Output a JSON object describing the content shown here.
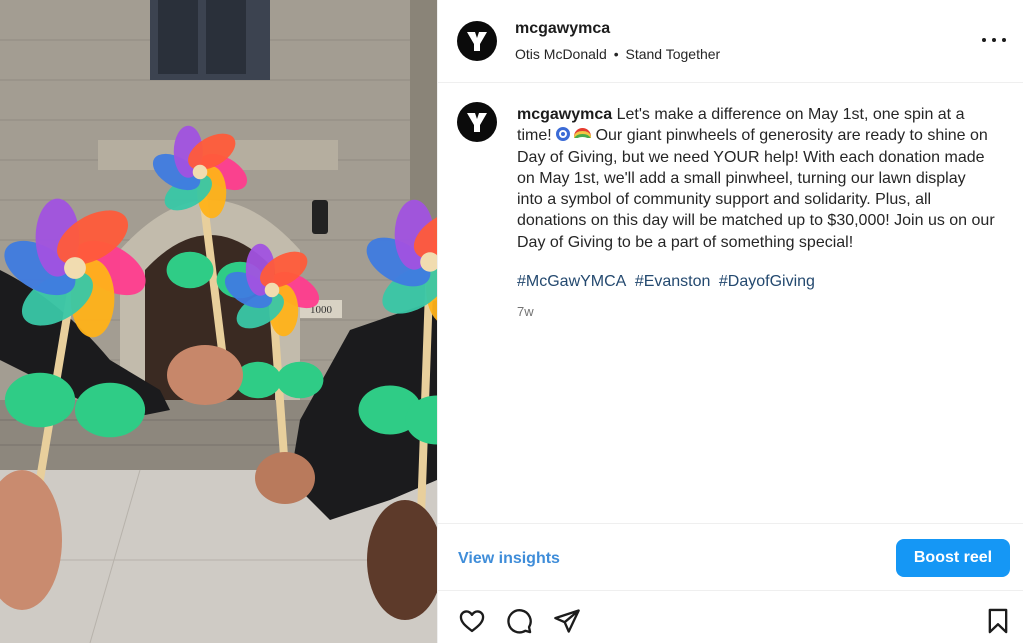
{
  "post": {
    "username": "mcgawymca",
    "subline_owner": "Otis McDonald",
    "subline_sep": "•",
    "subline_track": "Stand Together",
    "more_icon": "more-horizontal-icon"
  },
  "caption": {
    "username": "mcgawymca",
    "part1": " Let's make a difference on May 1st, one spin at a time! ",
    "part2": " Our giant pinwheels of generosity are ready to shine on Day of Giving, but we need YOUR help! With each donation made on May 1st, we'll add a small pinwheel, turning our lawn display into a symbol of community support and solidarity. Plus, all donations on this day will be matched up to $30,000! Join us on our Day of Giving to be a part of something special!",
    "emojis": [
      "cyclone-emoji",
      "rainbow-emoji"
    ],
    "hashtags": [
      "#McGawYMCA",
      "#Evanston",
      "#DayofGiving"
    ],
    "timestamp": "7w"
  },
  "insights": {
    "view_label": "View insights",
    "boost_label": "Boost reel"
  },
  "actions": {
    "icons": [
      "heart-icon",
      "comment-icon",
      "share-icon",
      "bookmark-icon"
    ]
  },
  "media": {
    "building_number": "1000",
    "pinwheel_colors": [
      "#ff3c8e",
      "#ffb219",
      "#39c7a6",
      "#3f7be0",
      "#a152e0",
      "#ff5b3a"
    ],
    "leaf_color": "#2fcc86"
  },
  "colors": {
    "link": "#3f8dd9",
    "hashtag": "#24496f",
    "primary_button": "#1597f5",
    "muted": "#737373"
  }
}
